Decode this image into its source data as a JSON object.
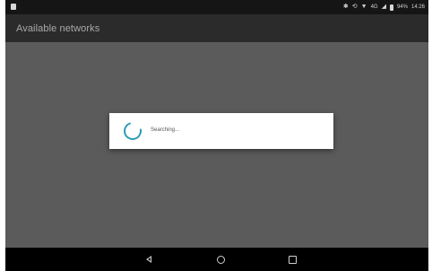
{
  "status_bar": {
    "network_type": "4G",
    "battery_percent": "94%",
    "time": "14:26",
    "icons": [
      "notification-icon",
      "bluetooth-icon",
      "data-sync-icon",
      "wifi-icon",
      "signal-icon",
      "battery-icon"
    ]
  },
  "toolbar": {
    "title": "Available networks"
  },
  "list": {
    "items": [
      "",
      ""
    ]
  },
  "dialog": {
    "message": "Searching...",
    "spinner_color": "#2a9db3"
  },
  "nav_bar": {
    "buttons": [
      "back-icon",
      "home-icon",
      "recents-icon"
    ]
  }
}
